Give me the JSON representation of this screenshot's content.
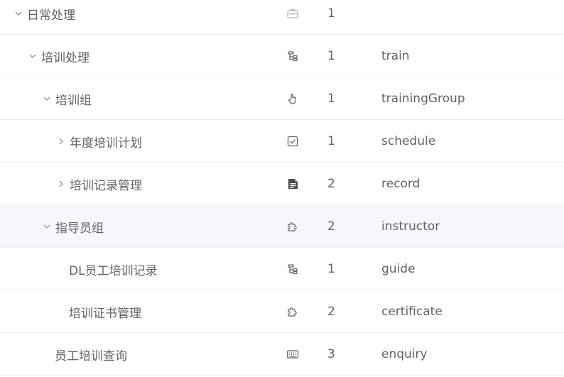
{
  "menu_tree": {
    "rows": [
      {
        "name": "日常处理",
        "caret": "chevron-down",
        "icon": "toolbox-icon",
        "order": "1",
        "path": ""
      },
      {
        "name": "培训处理",
        "caret": "chevron-down",
        "icon": "tree-icon",
        "order": "1",
        "path": "train"
      },
      {
        "name": "培训组",
        "caret": "chevron-down",
        "icon": "pointer-icon",
        "order": "1",
        "path": "trainingGroup"
      },
      {
        "name": "年度培训计划",
        "caret": "chevron-right",
        "icon": "checkbox-icon",
        "order": "1",
        "path": "schedule"
      },
      {
        "name": "培训记录管理",
        "caret": "chevron-right",
        "icon": "document-icon",
        "order": "2",
        "path": "record"
      },
      {
        "name": "指导员组",
        "caret": "chevron-down",
        "icon": "puzzle-icon",
        "order": "2",
        "path": "instructor"
      },
      {
        "name": "DL员工培训记录",
        "caret": "",
        "icon": "tree-icon",
        "order": "1",
        "path": "guide"
      },
      {
        "name": "培训证书管理",
        "caret": "",
        "icon": "puzzle-icon",
        "order": "2",
        "path": "certificate"
      },
      {
        "name": "员工培训查询",
        "caret": "",
        "icon": "keyboard-icon",
        "order": "3",
        "path": "enquiry"
      }
    ]
  },
  "colors": {
    "text": "#606266",
    "icon": "#909399",
    "border": "#ebeef5",
    "highlight_row": "#f5f7fa"
  }
}
